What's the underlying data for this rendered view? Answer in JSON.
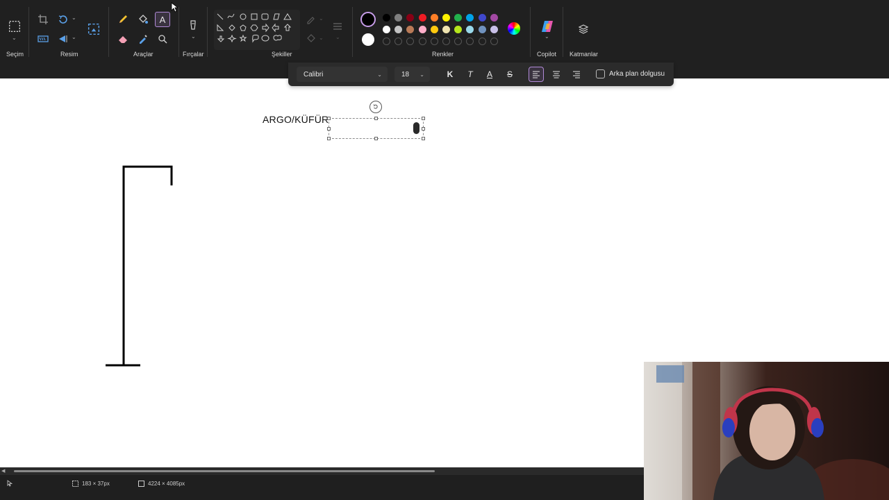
{
  "ribbon": {
    "groups": {
      "selection": "Seçim",
      "image": "Resim",
      "tools": "Araçlar",
      "brushes": "Fırçalar",
      "shapes": "Şekiller",
      "colors": "Renkler",
      "copilot": "Copilot",
      "layers": "Katmanlar"
    },
    "palette": {
      "primary": "#000000",
      "secondary": "#ffffff",
      "row1": [
        "#000000",
        "#7f7f7f",
        "#880015",
        "#ed1c24",
        "#ff7f27",
        "#fff200",
        "#22b14c",
        "#00a2e8",
        "#3f48cc",
        "#a349a4"
      ],
      "row2": [
        "#ffffff",
        "#c3c3c3",
        "#b97a57",
        "#ffaec9",
        "#ffc90e",
        "#efe4b0",
        "#b5e61d",
        "#99d9ea",
        "#7092be",
        "#c8bfe7"
      ]
    }
  },
  "text_toolbar": {
    "font": "Calibri",
    "size": "18",
    "bold": "K",
    "italic": "T",
    "underline": "A",
    "strike": "S",
    "background_fill": "Arka plan dolgusu"
  },
  "canvas": {
    "text": "ARGO/KÜFÜR"
  },
  "status": {
    "selection_size": "183 × 37px",
    "canvas_size": "4224 × 4085px"
  }
}
